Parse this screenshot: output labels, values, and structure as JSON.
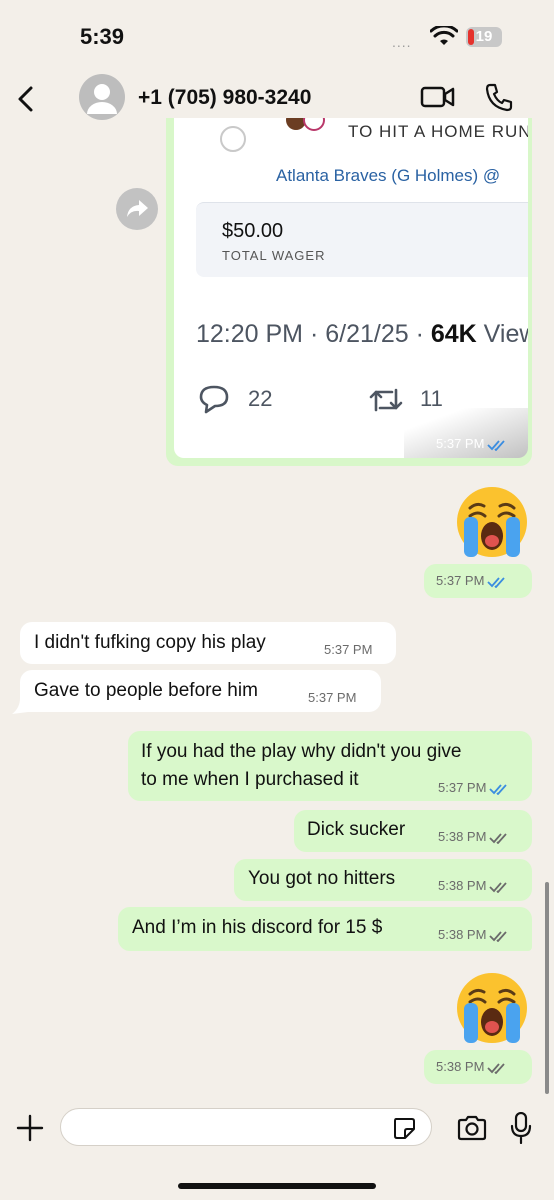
{
  "status_bar": {
    "time": "5:39",
    "signal": "....",
    "battery": "19"
  },
  "header": {
    "contact": "+1 (705) 980-3240"
  },
  "shared_screenshot": {
    "bet_label": "TO HIT A HOME RUN",
    "team": "Atlanta Braves (G Holmes) @",
    "wager_amount": "$50.00",
    "wager_label": "TOTAL WAGER",
    "tweet_time": "12:20 PM · 6/21/25 · ",
    "tweet_views_num": "64K",
    "tweet_views_label": " Views",
    "replies": "22",
    "retweets": "11",
    "timestamp": "5:37 PM"
  },
  "messages": [
    {
      "dir": "out",
      "kind": "emoji",
      "emoji": "loudly-crying-face",
      "time": "5:37 PM",
      "status": "read"
    },
    {
      "dir": "in",
      "text": "I didn't fufking copy his play",
      "time": "5:37 PM"
    },
    {
      "dir": "in",
      "text": "Gave to people before him",
      "time": "5:37 PM"
    },
    {
      "dir": "out",
      "text_line1": "If you had the play why didn't you give",
      "text_line2": "to me when I purchased it",
      "time": "5:37 PM",
      "status": "read"
    },
    {
      "dir": "out",
      "text": "Dick sucker",
      "time": "5:38 PM",
      "status": "delivered"
    },
    {
      "dir": "out",
      "text": "You got no hitters",
      "time": "5:38 PM",
      "status": "delivered"
    },
    {
      "dir": "out",
      "text": "And I’m in his discord for 15 $",
      "time": "5:38 PM",
      "status": "delivered"
    },
    {
      "dir": "out",
      "kind": "emoji",
      "emoji": "loudly-crying-face",
      "time": "5:38 PM",
      "status": "delivered"
    }
  ],
  "input": {
    "placeholder": ""
  },
  "colors": {
    "outgoing": "#d9f8cb",
    "incoming": "#ffffff",
    "background": "#f3efe9",
    "read_tick": "#3b8de0"
  }
}
